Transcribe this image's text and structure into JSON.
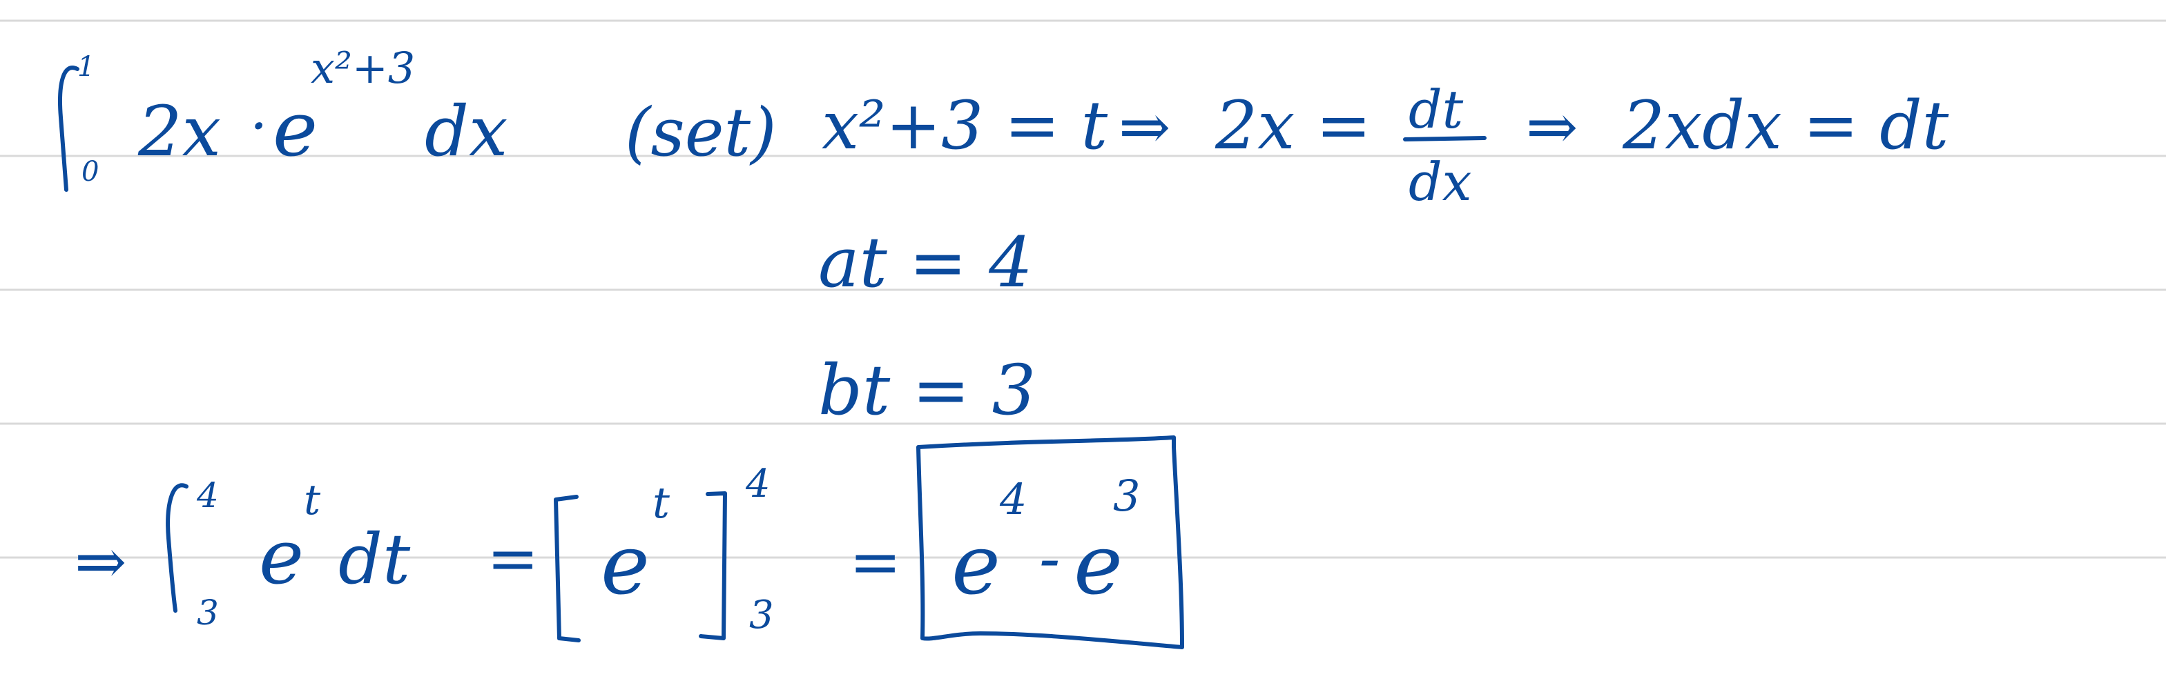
{
  "note": {
    "ink_color": "#0b4a9c",
    "line_color": "#d9d9d9",
    "line1": {
      "integral_lower": "0",
      "integral_upper": "1",
      "integrand_factor": "2x",
      "dot": "·",
      "base": "e",
      "exponent": "x²+3",
      "differential": "dx",
      "set_label": "(set)",
      "substitution": "x²+3 = t",
      "implies_1": "⇒",
      "derivative_lhs": "2x =",
      "derivative_num": "dt",
      "derivative_den": "dx",
      "implies_2": "⇒",
      "result": "2xdx = dt"
    },
    "line2": {
      "upper_limit": "at = 4"
    },
    "line3": {
      "lower_limit": "bt = 3"
    },
    "line4": {
      "implies": "⇒",
      "integral_lower": "3",
      "integral_upper": "4",
      "integrand_base": "e",
      "integrand_exp": "t",
      "differential": "dt",
      "equals_1": "=",
      "bracket_base": "e",
      "bracket_exp": "t",
      "bracket_lower": "3",
      "bracket_upper": "4",
      "equals_2": "=",
      "answer_base_1": "e",
      "answer_exp_1": "4",
      "answer_minus": "-",
      "answer_base_2": "e",
      "answer_exp_2": "3"
    }
  }
}
